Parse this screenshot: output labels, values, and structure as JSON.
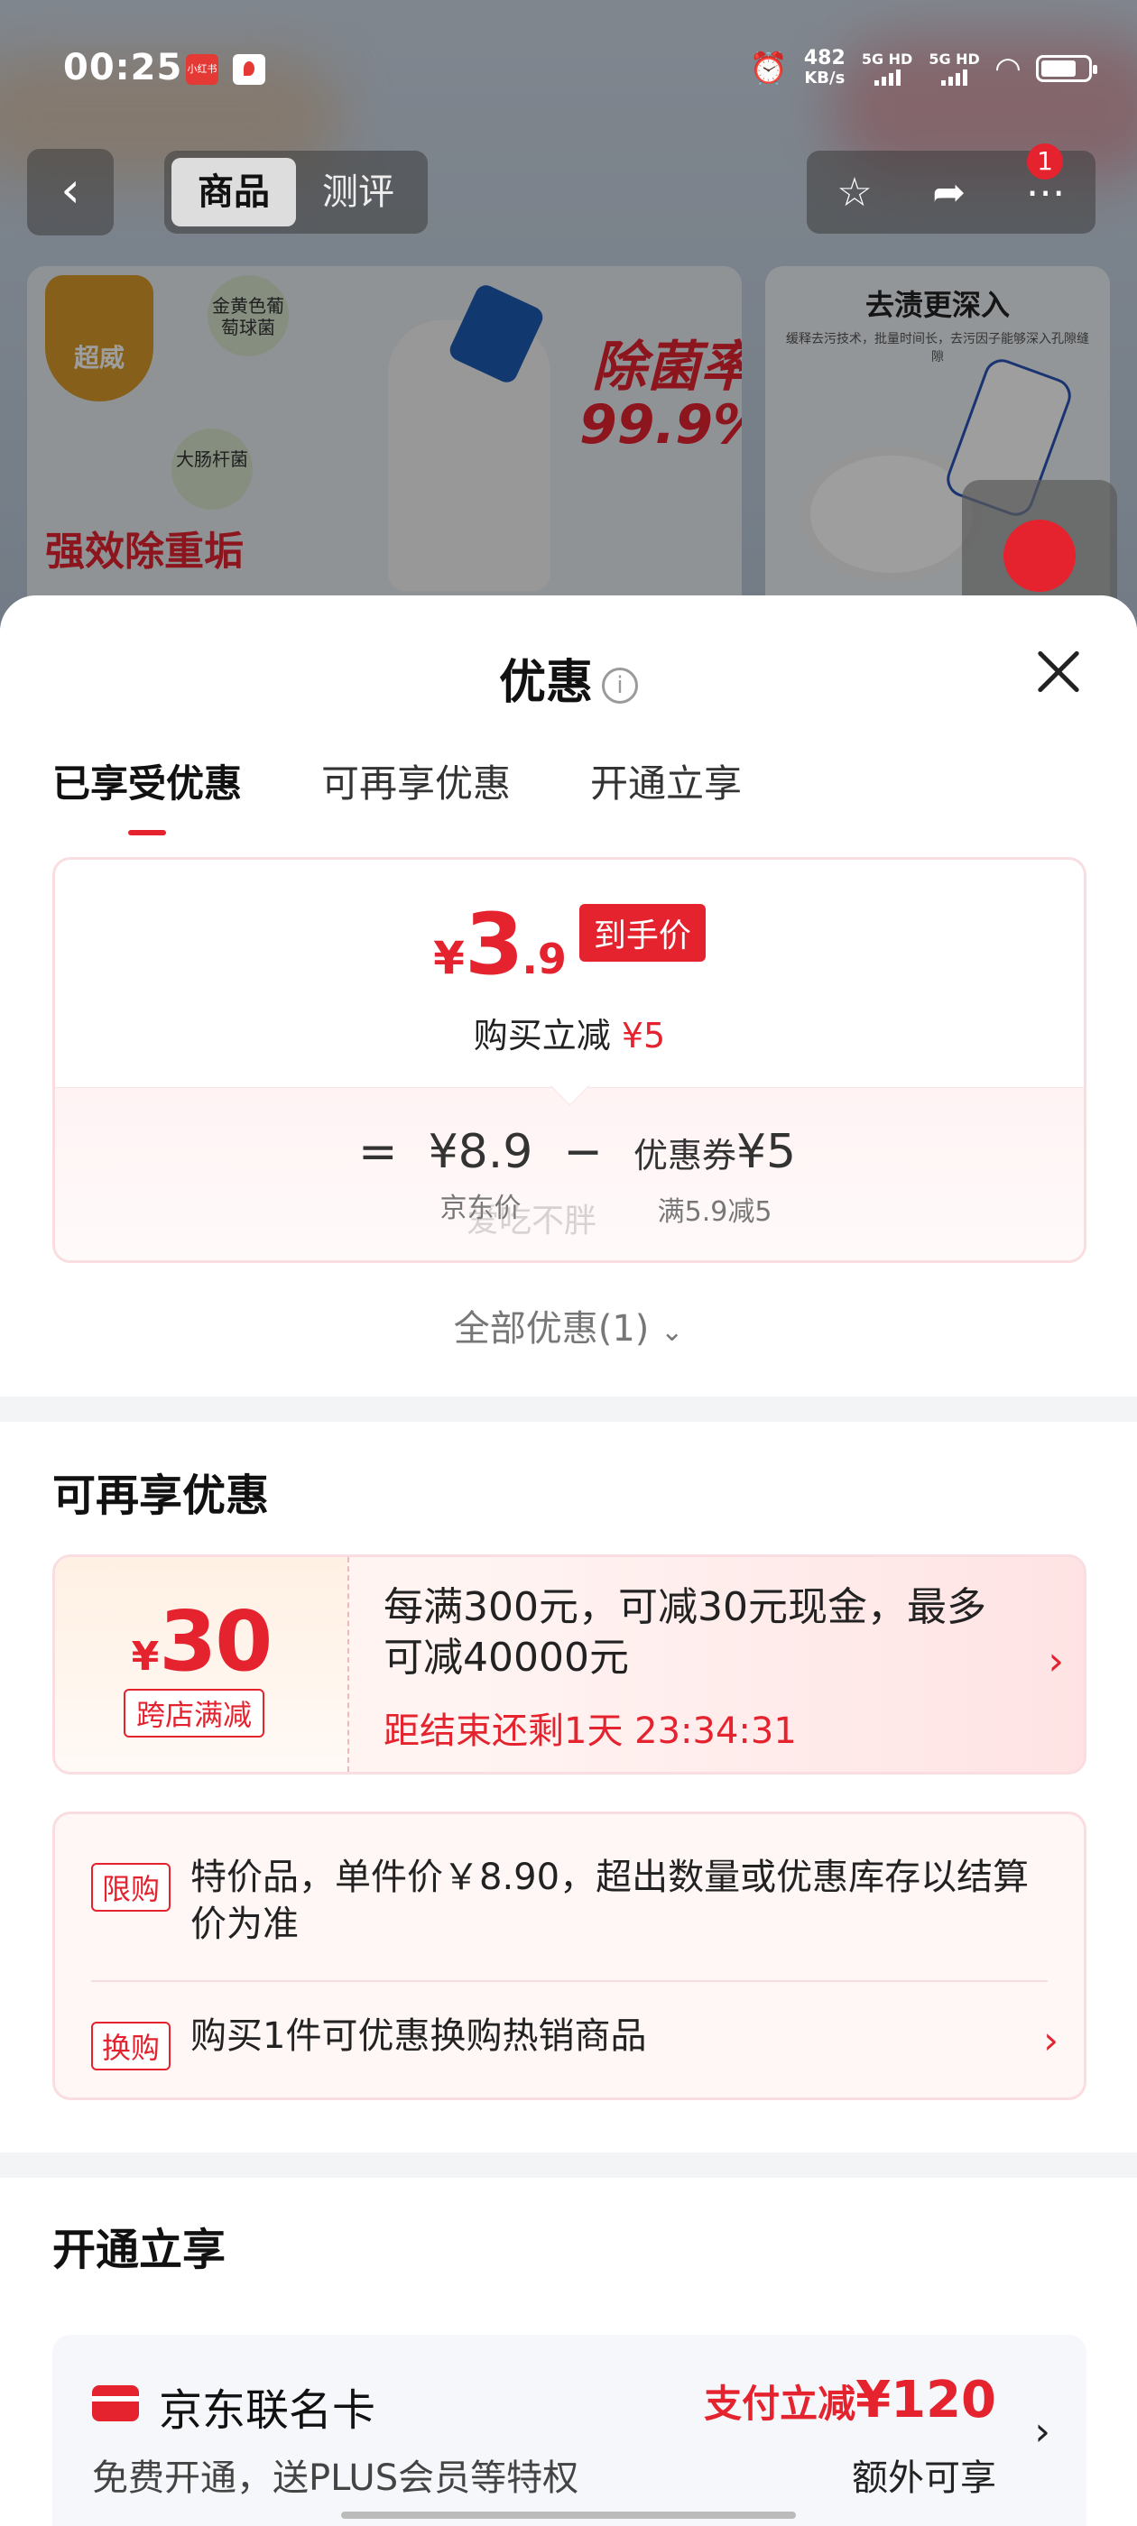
{
  "status_bar": {
    "time": "00:25",
    "app_badge": "小红书",
    "net_speed": "482",
    "net_speed_unit": "KB/s",
    "sim1": "5G HD",
    "sim2": "5G HD"
  },
  "nav": {
    "tab_goods": "商品",
    "tab_review": "测评",
    "more_badge": "1"
  },
  "hero": {
    "left_slogan": "强效除重垢",
    "left_rate": "除菌率",
    "left_rate_value": "99.9%",
    "left_brand": "超威",
    "germ_a": "金黄色葡萄球菌",
    "germ_b": "大肠杆菌",
    "right_title": "去渍更深入",
    "right_sub": "缓释去污技术，批量时间长，去污因子能够深入孔隙缝隙"
  },
  "sheet": {
    "title": "优惠",
    "info_glyph": "i",
    "tabs": [
      "已享受优惠",
      "可再享优惠",
      "开通立享"
    ],
    "price": {
      "yen": "¥",
      "integer": "3",
      "decimal": ".9",
      "tag": "到手价",
      "sub_label": "购买立减",
      "sub_value": "¥5"
    },
    "formula": {
      "eq": "=",
      "price": "¥8.9",
      "price_label": "京东价",
      "minus": "−",
      "coupon_label": "优惠券",
      "coupon_value": "¥5",
      "coupon_rule": "满5.9减5"
    },
    "watermark": "爱吃不胖",
    "all_offers": "全部优惠(1)",
    "section_more": "可再享优惠",
    "coupon": {
      "yen": "¥",
      "amount": "30",
      "tag": "跨店满减",
      "text": "每满300元，可减30元现金，最多可减40000元",
      "timer": "距结束还剩1天 23:34:31",
      "arrow": "›"
    },
    "rules": [
      {
        "tag": "限购",
        "text": "特价品，单件价￥8.90，超出数量或优惠库存以结算价为准"
      },
      {
        "tag": "换购",
        "text": "购买1件可优惠换购热销商品",
        "arrow": "›"
      }
    ],
    "section_open": "开通立享",
    "card": {
      "name": "京东联名卡",
      "desc": "免费开通，送PLUS会员等特权",
      "promo_label": "支付立减",
      "promo_value": "¥120",
      "extra": "额外可享",
      "arrow": "›"
    }
  },
  "colors": {
    "accent": "#e4232f",
    "card_border": "#fadde0",
    "divider": "#f3f4f6"
  }
}
